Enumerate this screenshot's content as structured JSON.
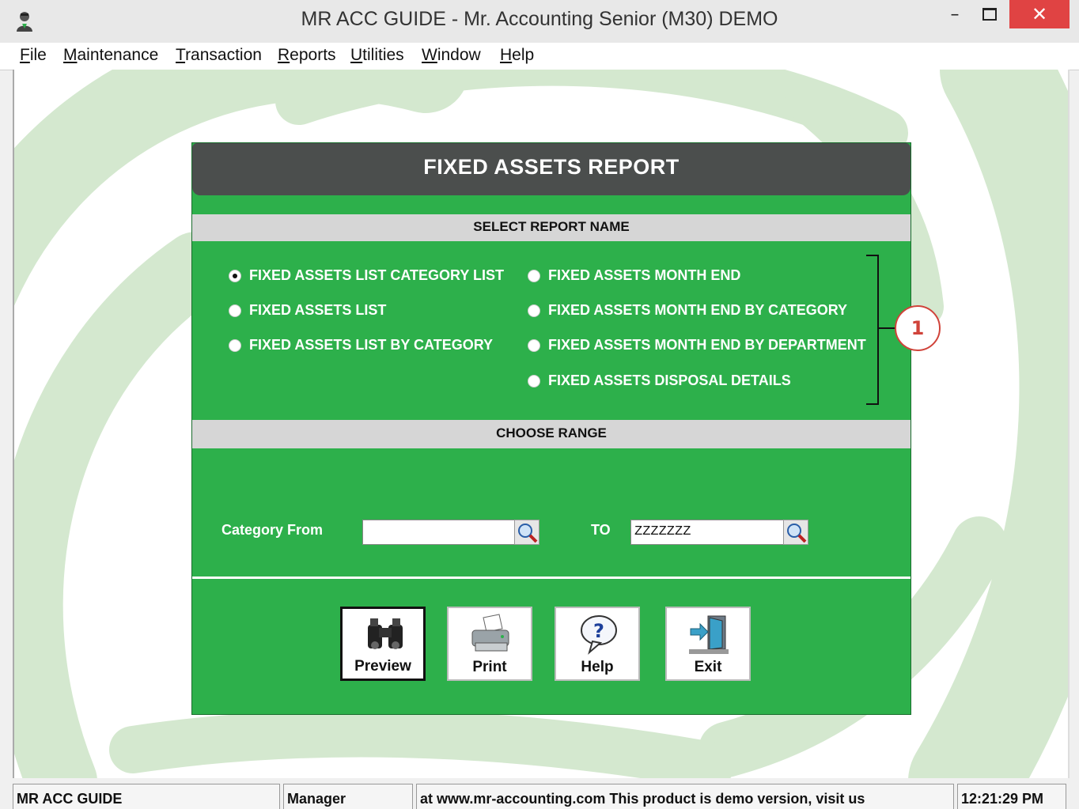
{
  "window": {
    "title": "MR ACC GUIDE - Mr. Accounting Senior (M30) DEMO",
    "minimize": "–",
    "close": "✕"
  },
  "menu": [
    "File",
    "Maintenance",
    "Transaction",
    "Reports",
    "Utilities",
    "Window",
    "Help"
  ],
  "dialog": {
    "title": "FIXED ASSETS REPORT",
    "section_report": "SELECT REPORT NAME",
    "section_range": "CHOOSE RANGE",
    "reports": [
      {
        "label": "FIXED ASSETS LIST CATEGORY LIST",
        "checked": true
      },
      {
        "label": "FIXED ASSETS LIST",
        "checked": false
      },
      {
        "label": "FIXED ASSETS LIST BY CATEGORY",
        "checked": false
      },
      {
        "label": "FIXED ASSETS MONTH END",
        "checked": false
      },
      {
        "label": "FIXED ASSETS MONTH END BY CATEGORY",
        "checked": false
      },
      {
        "label": "FIXED ASSETS MONTH END BY DEPARTMENT",
        "checked": false
      },
      {
        "label": "FIXED ASSETS DISPOSAL DETAILS",
        "checked": false
      }
    ],
    "callout": "1",
    "range": {
      "from_label": "Category From",
      "from_value": "",
      "to_label": "TO",
      "to_value": "ZZZZZZZ"
    },
    "buttons": {
      "preview": "Preview",
      "print": "Print",
      "help": "Help",
      "exit": "Exit"
    }
  },
  "status": {
    "app": "MR ACC GUIDE",
    "user": "Manager",
    "message": "at www.mr-accounting.com This product is demo version, visit us",
    "time": "12:21:29 PM"
  },
  "colors": {
    "dialog_green": "#2db04b",
    "header_dark": "#4b4e4d",
    "close_red": "#e04343",
    "callout_red": "#d0433a"
  }
}
